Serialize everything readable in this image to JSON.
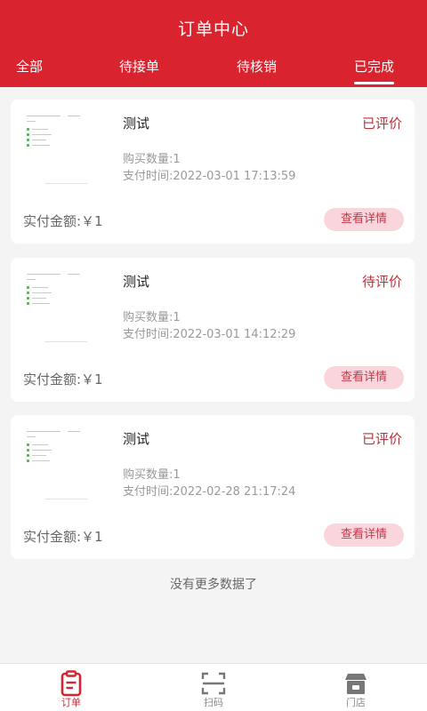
{
  "header": {
    "title": "订单中心"
  },
  "tabs": [
    {
      "label": "全部"
    },
    {
      "label": "待接单"
    },
    {
      "label": "待核销"
    },
    {
      "label": "已完成"
    }
  ],
  "active_tab": "已完成",
  "orders": [
    {
      "name": "测试",
      "status": "已评价",
      "quantity": "购买数量:1",
      "pay_time": "支付时间:2022-03-01 17:13:59",
      "amount": "实付金额:￥1",
      "detail_label": "查看详情"
    },
    {
      "name": "测试",
      "status": "待评价",
      "quantity": "购买数量:1",
      "pay_time": "支付时间:2022-03-01 14:12:29",
      "amount": "实付金额:￥1",
      "detail_label": "查看详情"
    },
    {
      "name": "测试",
      "status": "已评价",
      "quantity": "购买数量:1",
      "pay_time": "支付时间:2022-02-28 21:17:24",
      "amount": "实付金额:￥1",
      "detail_label": "查看详情"
    }
  ],
  "footer_note": "没有更多数据了",
  "bottom_nav": [
    {
      "label": "订单",
      "icon": "order-clipboard-icon"
    },
    {
      "label": "扫码",
      "icon": "scan-icon"
    },
    {
      "label": "门店",
      "icon": "store-icon"
    }
  ],
  "colors": {
    "brand_red": "#d9232f",
    "status_red": "#b3343f",
    "button_bg": "#f9d6dc",
    "page_bg": "#f4f4f4"
  }
}
